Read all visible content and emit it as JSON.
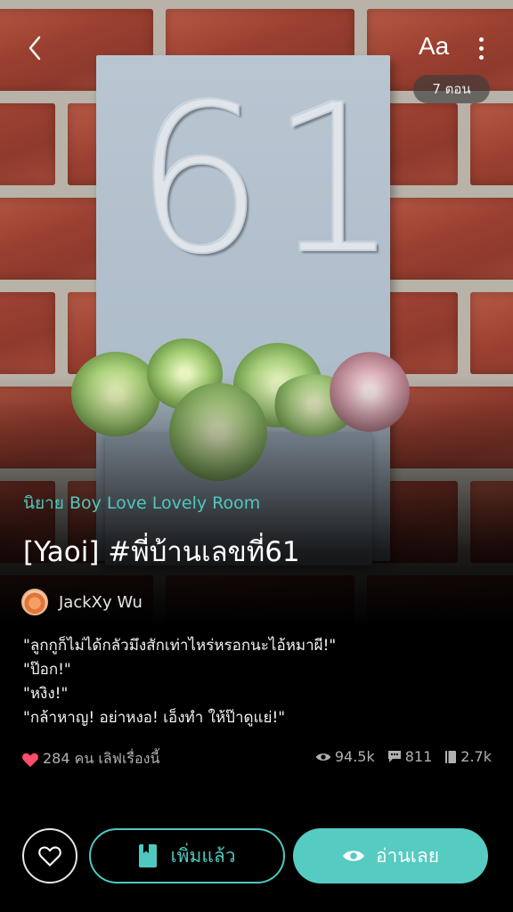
{
  "header": {
    "font_size_label": "Aa",
    "episode_count": "7 ตอน"
  },
  "cover": {
    "house_number": "61"
  },
  "story": {
    "category": "นิยาย Boy Love Lovely Room",
    "title": "[Yaoi] #พี่บ้านเลขที่61",
    "author": "JackXy Wu",
    "synopsis": [
      "\"ลูกกูก็ไม่ได้กลัวมึงสักเท่าไหร่หรอกนะไอ้หมาผี!\"",
      " \"ป๊อก!\"",
      " \"หงิง!\"",
      " \"กล้าหาญ! อย่าหงอ! เอ็งทำ ให้ป๊าดูแย่!\""
    ]
  },
  "stats": {
    "likes_text": "284 คน เลิฟเรื่องนี้",
    "views": "94.5k",
    "comments": "811",
    "chapters_read": "2.7k"
  },
  "actions": {
    "library_label": "เพิ่มแล้ว",
    "read_label": "อ่านเลย"
  },
  "colors": {
    "accent": "#56cbc2",
    "like": "#ff4d6d",
    "background": "#000000"
  },
  "icons": {
    "back": "chevron-left-icon",
    "font": "font-size-icon",
    "more": "more-vertical-icon",
    "heart": "heart-icon",
    "eye": "eye-icon",
    "comment": "comment-icon",
    "book": "book-icon",
    "bookmark": "bookmark-icon"
  }
}
